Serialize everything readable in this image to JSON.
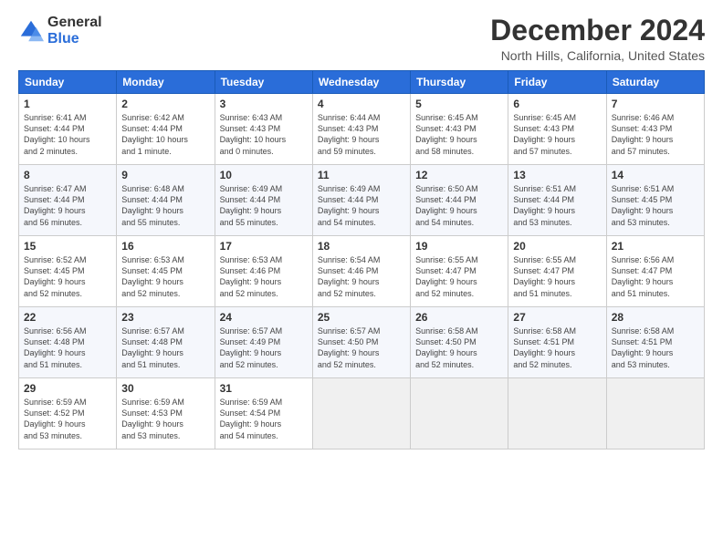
{
  "logo": {
    "general": "General",
    "blue": "Blue"
  },
  "title": "December 2024",
  "subtitle": "North Hills, California, United States",
  "days_of_week": [
    "Sunday",
    "Monday",
    "Tuesday",
    "Wednesday",
    "Thursday",
    "Friday",
    "Saturday"
  ],
  "weeks": [
    [
      {
        "day": "1",
        "sunrise": "6:41 AM",
        "sunset": "4:44 PM",
        "daylight": "10 hours and 2 minutes."
      },
      {
        "day": "2",
        "sunrise": "6:42 AM",
        "sunset": "4:44 PM",
        "daylight": "10 hours and 1 minute."
      },
      {
        "day": "3",
        "sunrise": "6:43 AM",
        "sunset": "4:43 PM",
        "daylight": "10 hours and 0 minutes."
      },
      {
        "day": "4",
        "sunrise": "6:44 AM",
        "sunset": "4:43 PM",
        "daylight": "9 hours and 59 minutes."
      },
      {
        "day": "5",
        "sunrise": "6:45 AM",
        "sunset": "4:43 PM",
        "daylight": "9 hours and 58 minutes."
      },
      {
        "day": "6",
        "sunrise": "6:45 AM",
        "sunset": "4:43 PM",
        "daylight": "9 hours and 57 minutes."
      },
      {
        "day": "7",
        "sunrise": "6:46 AM",
        "sunset": "4:43 PM",
        "daylight": "9 hours and 57 minutes."
      }
    ],
    [
      {
        "day": "8",
        "sunrise": "6:47 AM",
        "sunset": "4:44 PM",
        "daylight": "9 hours and 56 minutes."
      },
      {
        "day": "9",
        "sunrise": "6:48 AM",
        "sunset": "4:44 PM",
        "daylight": "9 hours and 55 minutes."
      },
      {
        "day": "10",
        "sunrise": "6:49 AM",
        "sunset": "4:44 PM",
        "daylight": "9 hours and 55 minutes."
      },
      {
        "day": "11",
        "sunrise": "6:49 AM",
        "sunset": "4:44 PM",
        "daylight": "9 hours and 54 minutes."
      },
      {
        "day": "12",
        "sunrise": "6:50 AM",
        "sunset": "4:44 PM",
        "daylight": "9 hours and 54 minutes."
      },
      {
        "day": "13",
        "sunrise": "6:51 AM",
        "sunset": "4:44 PM",
        "daylight": "9 hours and 53 minutes."
      },
      {
        "day": "14",
        "sunrise": "6:51 AM",
        "sunset": "4:45 PM",
        "daylight": "9 hours and 53 minutes."
      }
    ],
    [
      {
        "day": "15",
        "sunrise": "6:52 AM",
        "sunset": "4:45 PM",
        "daylight": "9 hours and 52 minutes."
      },
      {
        "day": "16",
        "sunrise": "6:53 AM",
        "sunset": "4:45 PM",
        "daylight": "9 hours and 52 minutes."
      },
      {
        "day": "17",
        "sunrise": "6:53 AM",
        "sunset": "4:46 PM",
        "daylight": "9 hours and 52 minutes."
      },
      {
        "day": "18",
        "sunrise": "6:54 AM",
        "sunset": "4:46 PM",
        "daylight": "9 hours and 52 minutes."
      },
      {
        "day": "19",
        "sunrise": "6:55 AM",
        "sunset": "4:47 PM",
        "daylight": "9 hours and 52 minutes."
      },
      {
        "day": "20",
        "sunrise": "6:55 AM",
        "sunset": "4:47 PM",
        "daylight": "9 hours and 51 minutes."
      },
      {
        "day": "21",
        "sunrise": "6:56 AM",
        "sunset": "4:47 PM",
        "daylight": "9 hours and 51 minutes."
      }
    ],
    [
      {
        "day": "22",
        "sunrise": "6:56 AM",
        "sunset": "4:48 PM",
        "daylight": "9 hours and 51 minutes."
      },
      {
        "day": "23",
        "sunrise": "6:57 AM",
        "sunset": "4:48 PM",
        "daylight": "9 hours and 51 minutes."
      },
      {
        "day": "24",
        "sunrise": "6:57 AM",
        "sunset": "4:49 PM",
        "daylight": "9 hours and 52 minutes."
      },
      {
        "day": "25",
        "sunrise": "6:57 AM",
        "sunset": "4:50 PM",
        "daylight": "9 hours and 52 minutes."
      },
      {
        "day": "26",
        "sunrise": "6:58 AM",
        "sunset": "4:50 PM",
        "daylight": "9 hours and 52 minutes."
      },
      {
        "day": "27",
        "sunrise": "6:58 AM",
        "sunset": "4:51 PM",
        "daylight": "9 hours and 52 minutes."
      },
      {
        "day": "28",
        "sunrise": "6:58 AM",
        "sunset": "4:51 PM",
        "daylight": "9 hours and 53 minutes."
      }
    ],
    [
      {
        "day": "29",
        "sunrise": "6:59 AM",
        "sunset": "4:52 PM",
        "daylight": "9 hours and 53 minutes."
      },
      {
        "day": "30",
        "sunrise": "6:59 AM",
        "sunset": "4:53 PM",
        "daylight": "9 hours and 53 minutes."
      },
      {
        "day": "31",
        "sunrise": "6:59 AM",
        "sunset": "4:54 PM",
        "daylight": "9 hours and 54 minutes."
      },
      null,
      null,
      null,
      null
    ]
  ],
  "labels": {
    "sunrise": "Sunrise:",
    "sunset": "Sunset:",
    "daylight": "Daylight:"
  }
}
